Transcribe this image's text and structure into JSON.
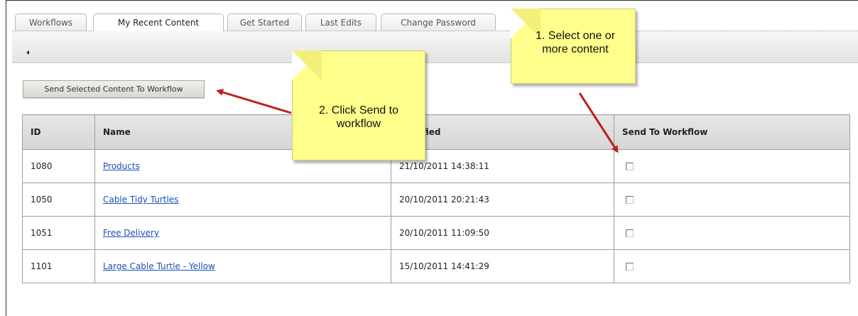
{
  "tabs": [
    {
      "label": "Workflows",
      "active": false
    },
    {
      "label": "My Recent Content",
      "active": true
    },
    {
      "label": "Get Started",
      "active": false
    },
    {
      "label": "Last Edits",
      "active": false
    },
    {
      "label": "Change Password",
      "active": false
    }
  ],
  "toolbar": {
    "collapse_icon": "caret-left-icon"
  },
  "send_button": {
    "label": "Send Selected Content To Workflow"
  },
  "table": {
    "headers": {
      "id": "ID",
      "name": "Name",
      "modified": "Modified",
      "send": "Send To Workflow"
    },
    "rows": [
      {
        "id": "1080",
        "name": "Products",
        "modified": "21/10/2011 14:38:11",
        "checked": false
      },
      {
        "id": "1050",
        "name": "Cable Tidy Turtles",
        "modified": "20/10/2011 20:21:43",
        "checked": false
      },
      {
        "id": "1051",
        "name": "Free Delivery",
        "modified": "20/10/2011 11:09:50",
        "checked": false
      },
      {
        "id": "1101",
        "name": "Large Cable Turtle - Yellow",
        "modified": "15/10/2011 14:41:29",
        "checked": false
      }
    ]
  },
  "callouts": {
    "step1": "1. Select one or more content",
    "step2": "2. Click Send to workflow"
  },
  "colors": {
    "note_fill": "#ffff8c",
    "arrow": "#c01f1f",
    "link": "#1c4fb8",
    "header_bg": "#dcdcdc"
  }
}
